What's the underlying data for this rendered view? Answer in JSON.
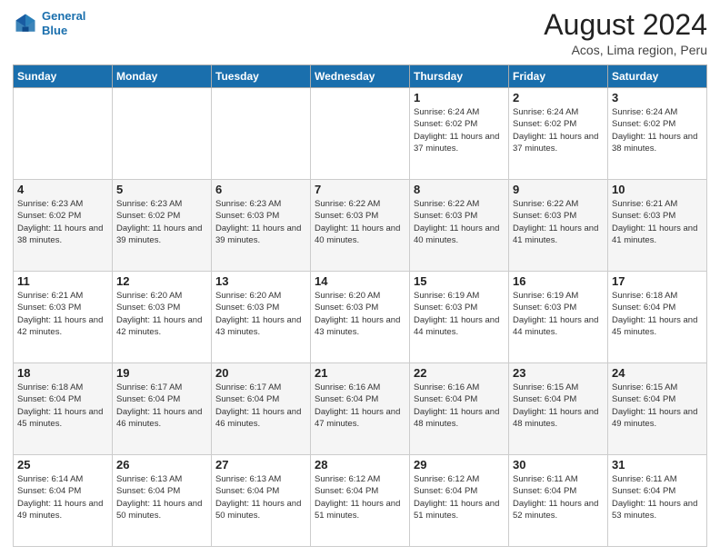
{
  "header": {
    "logo_line1": "General",
    "logo_line2": "Blue",
    "month_title": "August 2024",
    "location": "Acos, Lima region, Peru"
  },
  "days_of_week": [
    "Sunday",
    "Monday",
    "Tuesday",
    "Wednesday",
    "Thursday",
    "Friday",
    "Saturday"
  ],
  "weeks": [
    [
      {
        "day": "",
        "info": ""
      },
      {
        "day": "",
        "info": ""
      },
      {
        "day": "",
        "info": ""
      },
      {
        "day": "",
        "info": ""
      },
      {
        "day": "1",
        "info": "Sunrise: 6:24 AM\nSunset: 6:02 PM\nDaylight: 11 hours\nand 37 minutes."
      },
      {
        "day": "2",
        "info": "Sunrise: 6:24 AM\nSunset: 6:02 PM\nDaylight: 11 hours\nand 37 minutes."
      },
      {
        "day": "3",
        "info": "Sunrise: 6:24 AM\nSunset: 6:02 PM\nDaylight: 11 hours\nand 38 minutes."
      }
    ],
    [
      {
        "day": "4",
        "info": "Sunrise: 6:23 AM\nSunset: 6:02 PM\nDaylight: 11 hours\nand 38 minutes."
      },
      {
        "day": "5",
        "info": "Sunrise: 6:23 AM\nSunset: 6:02 PM\nDaylight: 11 hours\nand 39 minutes."
      },
      {
        "day": "6",
        "info": "Sunrise: 6:23 AM\nSunset: 6:03 PM\nDaylight: 11 hours\nand 39 minutes."
      },
      {
        "day": "7",
        "info": "Sunrise: 6:22 AM\nSunset: 6:03 PM\nDaylight: 11 hours\nand 40 minutes."
      },
      {
        "day": "8",
        "info": "Sunrise: 6:22 AM\nSunset: 6:03 PM\nDaylight: 11 hours\nand 40 minutes."
      },
      {
        "day": "9",
        "info": "Sunrise: 6:22 AM\nSunset: 6:03 PM\nDaylight: 11 hours\nand 41 minutes."
      },
      {
        "day": "10",
        "info": "Sunrise: 6:21 AM\nSunset: 6:03 PM\nDaylight: 11 hours\nand 41 minutes."
      }
    ],
    [
      {
        "day": "11",
        "info": "Sunrise: 6:21 AM\nSunset: 6:03 PM\nDaylight: 11 hours\nand 42 minutes."
      },
      {
        "day": "12",
        "info": "Sunrise: 6:20 AM\nSunset: 6:03 PM\nDaylight: 11 hours\nand 42 minutes."
      },
      {
        "day": "13",
        "info": "Sunrise: 6:20 AM\nSunset: 6:03 PM\nDaylight: 11 hours\nand 43 minutes."
      },
      {
        "day": "14",
        "info": "Sunrise: 6:20 AM\nSunset: 6:03 PM\nDaylight: 11 hours\nand 43 minutes."
      },
      {
        "day": "15",
        "info": "Sunrise: 6:19 AM\nSunset: 6:03 PM\nDaylight: 11 hours\nand 44 minutes."
      },
      {
        "day": "16",
        "info": "Sunrise: 6:19 AM\nSunset: 6:03 PM\nDaylight: 11 hours\nand 44 minutes."
      },
      {
        "day": "17",
        "info": "Sunrise: 6:18 AM\nSunset: 6:04 PM\nDaylight: 11 hours\nand 45 minutes."
      }
    ],
    [
      {
        "day": "18",
        "info": "Sunrise: 6:18 AM\nSunset: 6:04 PM\nDaylight: 11 hours\nand 45 minutes."
      },
      {
        "day": "19",
        "info": "Sunrise: 6:17 AM\nSunset: 6:04 PM\nDaylight: 11 hours\nand 46 minutes."
      },
      {
        "day": "20",
        "info": "Sunrise: 6:17 AM\nSunset: 6:04 PM\nDaylight: 11 hours\nand 46 minutes."
      },
      {
        "day": "21",
        "info": "Sunrise: 6:16 AM\nSunset: 6:04 PM\nDaylight: 11 hours\nand 47 minutes."
      },
      {
        "day": "22",
        "info": "Sunrise: 6:16 AM\nSunset: 6:04 PM\nDaylight: 11 hours\nand 48 minutes."
      },
      {
        "day": "23",
        "info": "Sunrise: 6:15 AM\nSunset: 6:04 PM\nDaylight: 11 hours\nand 48 minutes."
      },
      {
        "day": "24",
        "info": "Sunrise: 6:15 AM\nSunset: 6:04 PM\nDaylight: 11 hours\nand 49 minutes."
      }
    ],
    [
      {
        "day": "25",
        "info": "Sunrise: 6:14 AM\nSunset: 6:04 PM\nDaylight: 11 hours\nand 49 minutes."
      },
      {
        "day": "26",
        "info": "Sunrise: 6:13 AM\nSunset: 6:04 PM\nDaylight: 11 hours\nand 50 minutes."
      },
      {
        "day": "27",
        "info": "Sunrise: 6:13 AM\nSunset: 6:04 PM\nDaylight: 11 hours\nand 50 minutes."
      },
      {
        "day": "28",
        "info": "Sunrise: 6:12 AM\nSunset: 6:04 PM\nDaylight: 11 hours\nand 51 minutes."
      },
      {
        "day": "29",
        "info": "Sunrise: 6:12 AM\nSunset: 6:04 PM\nDaylight: 11 hours\nand 51 minutes."
      },
      {
        "day": "30",
        "info": "Sunrise: 6:11 AM\nSunset: 6:04 PM\nDaylight: 11 hours\nand 52 minutes."
      },
      {
        "day": "31",
        "info": "Sunrise: 6:11 AM\nSunset: 6:04 PM\nDaylight: 11 hours\nand 53 minutes."
      }
    ]
  ]
}
